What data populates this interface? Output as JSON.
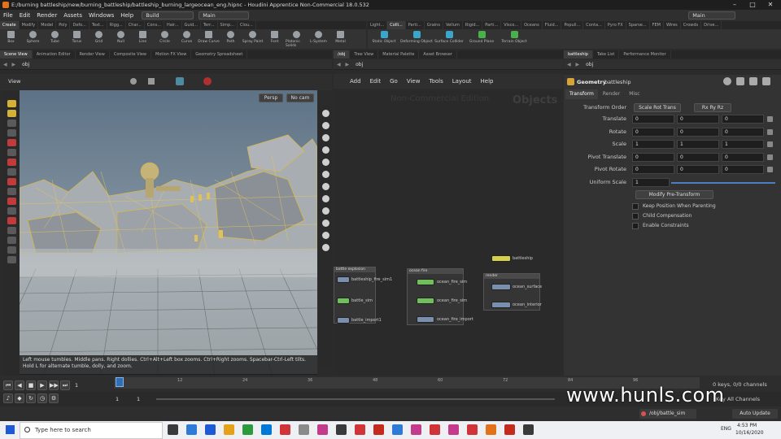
{
  "window": {
    "title": "E:/burning battleship/new/burning_battleship/battleship_burning_largeocean_eng.hipnc - Houdini Apprentice Non-Commercial 18.0.532"
  },
  "menu": {
    "items": [
      "File",
      "Edit",
      "Render",
      "Assets",
      "Windows",
      "Help"
    ],
    "desktop_dropdown": "Build",
    "main_dropdown": "Main",
    "right_dropdown": "Main"
  },
  "shelf": {
    "tabs_left": [
      "Create",
      "Modify",
      "Model",
      "Poly",
      "Defo...",
      "Text...",
      "Rigg...",
      "Char...",
      "Cons...",
      "Hair...",
      "Guid...",
      "Terr...",
      "Simp...",
      "Clou..."
    ],
    "tabs_right": [
      "Light...",
      "Colli...",
      "Parti...",
      "Grains",
      "Vellum",
      "Rigid...",
      "Parti...",
      "Visco...",
      "Oceans",
      "Fluid...",
      "Populi...",
      "Conta...",
      "Pyro FX",
      "Sparse...",
      "FEM",
      "Wires",
      "Crowds",
      "Drive..."
    ],
    "tools_left": [
      "Box",
      "Sphere",
      "Tube",
      "Torus",
      "Grid",
      "Null",
      "Line",
      "Circle",
      "Curve",
      "Draw Curve",
      "Path",
      "Spray Paint",
      "Font",
      "Platonic Solids",
      "L-System",
      "Metal"
    ],
    "tools_right": [
      "Static Object",
      "Deforming Object",
      "Surface Collider",
      "Ground Plane",
      "Terrain Object"
    ]
  },
  "scene_tabs": [
    "Scene View",
    "Animation Editor",
    "Render View",
    "Composite View",
    "Motion FX View",
    "Geometry Spreadsheet"
  ],
  "scene_path": "obj",
  "viewport": {
    "label": "View",
    "persp": "Persp",
    "cam": "No cam",
    "help_text": "Left mouse tumbles. Middle pans. Right dollies. Ctrl+Alt+Left box zooms. Ctrl+Right zooms. Spacebar-Ctrl-Left tilts. Hold L for alternate tumble, dolly, and zoom."
  },
  "network": {
    "tabs": [
      "/obj",
      "Tree View",
      "Material Palette",
      "Asset Browser"
    ],
    "path": "obj",
    "menu": [
      "Add",
      "Edit",
      "Go",
      "View",
      "Tools",
      "Layout",
      "Help"
    ],
    "watermark_edition": "Non-Commercial Edition",
    "context_label": "Objects",
    "boxes": [
      {
        "title": "battle explosion",
        "nodes": [
          "battleship_fire_sim1",
          "battle_sim",
          "battle_import1"
        ]
      },
      {
        "title": "ocean fire",
        "nodes": [
          "ocean_fire_sim",
          "ocean_fire_sim",
          "ocean_fire_import"
        ]
      },
      {
        "title": "render",
        "nodes": [
          "ocean_surface",
          "ocean_interior"
        ]
      }
    ],
    "battleship_node": "battleship"
  },
  "params": {
    "tabs": [
      "battleship",
      "Take List",
      "Performance Monitor"
    ],
    "path": "obj",
    "node_type": "Geometry",
    "node_name": "battleship",
    "subtabs": [
      "Transform",
      "Render",
      "Misc"
    ],
    "transform_order_label": "Transform Order",
    "transform_order_value": "Scale Rot Trans",
    "rotate_order_value": "Rx Ry Rz",
    "rows": [
      {
        "label": "Translate",
        "values": [
          "0",
          "0",
          "0"
        ]
      },
      {
        "label": "Rotate",
        "values": [
          "0",
          "0",
          "0"
        ]
      },
      {
        "label": "Scale",
        "values": [
          "1",
          "1",
          "1"
        ]
      },
      {
        "label": "Pivot Translate",
        "values": [
          "0",
          "0",
          "0"
        ]
      },
      {
        "label": "Pivot Rotate",
        "values": [
          "0",
          "0",
          "0"
        ]
      }
    ],
    "uniform_scale_label": "Uniform Scale",
    "uniform_scale_value": "1",
    "modify_button": "Modify Pre-Transform",
    "checkboxes": [
      "Keep Position When Parenting",
      "Child Compensation",
      "Enable Constraints"
    ]
  },
  "timeline": {
    "current_frame": "1",
    "ticks": [
      "12",
      "24",
      "36",
      "48",
      "60",
      "72",
      "84",
      "96"
    ],
    "start": "1",
    "start2": "1",
    "keys_label": "0 keys, 0/0 channels",
    "key_all": "Key All Channels"
  },
  "status": {
    "path": "/obj/battle_sim",
    "auto_update": "Auto Update"
  },
  "taskbar": {
    "search_placeholder": "Type here to search",
    "lang": "ENG",
    "time": "4:53 PM",
    "date": "10/16/2020"
  },
  "watermark": "www.hunls.com"
}
